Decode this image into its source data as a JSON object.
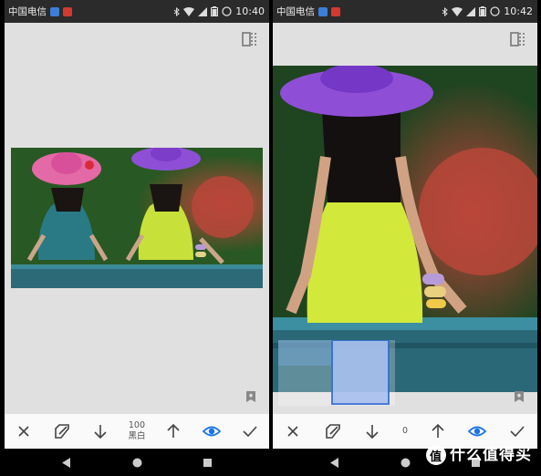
{
  "left": {
    "status": {
      "carrier": "中国电信",
      "time": "10:40"
    },
    "toolbar": {
      "value_number": "100",
      "value_label": "黑白"
    }
  },
  "right": {
    "status": {
      "carrier": "中国电信",
      "time": "10:42"
    },
    "toolbar": {
      "value_number": "0",
      "value_label": ""
    }
  },
  "watermark": {
    "circle_char": "值",
    "text": "什么值得买"
  },
  "colors": {
    "accent": "#1a73e8",
    "toolbar_bg": "#fafafa",
    "app_bg": "#e0e0e0"
  },
  "icons": [
    "cancel-icon",
    "brush-icon",
    "down-arrow-icon",
    "up-arrow-icon",
    "eye-icon",
    "check-icon",
    "compare-icon",
    "bookmark-icon"
  ]
}
